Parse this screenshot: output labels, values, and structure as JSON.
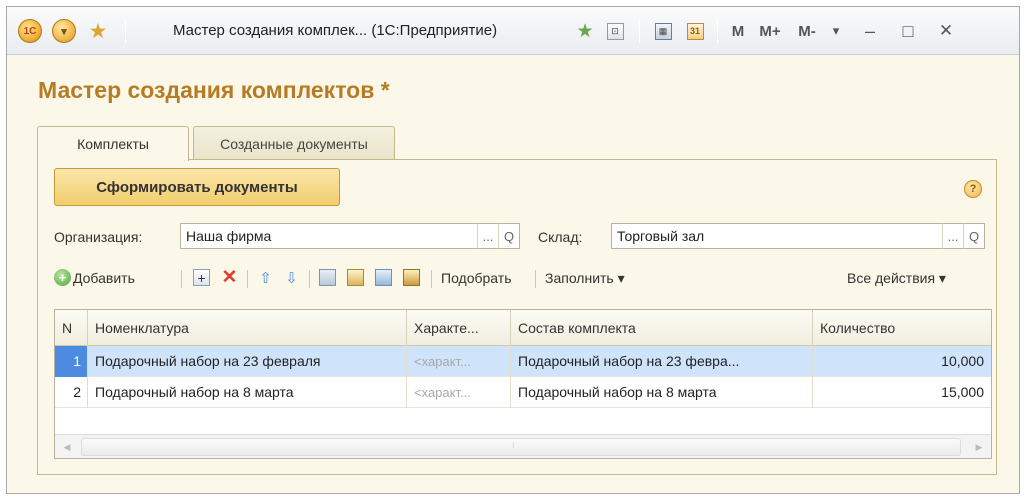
{
  "titlebar": {
    "title": "Мастер создания комплек... (1С:Предприятие)",
    "logo_text": "1С",
    "cal_text": "31",
    "m_label": "M",
    "m_plus_label": "M+",
    "m_minus_label": "M-",
    "minimize_glyph": "–",
    "restore_glyph": "□",
    "close_glyph": "✕",
    "dropdown_glyph": "▾"
  },
  "form": {
    "title": "Мастер создания комплектов *"
  },
  "tabs": [
    {
      "label": "Комплекты"
    },
    {
      "label": "Созданные документы"
    }
  ],
  "actions": {
    "generate_label": "Сформировать документы",
    "help_glyph": "?"
  },
  "fields": {
    "organization_label": "Организация:",
    "organization_value": "Наша фирма",
    "warehouse_label": "Склад:",
    "warehouse_value": "Торговый зал",
    "choose_glyph": "...",
    "search_glyph": "Q"
  },
  "commandbar": {
    "add_label": "Добавить",
    "pick_label": "Подобрать",
    "fill_label": "Заполнить ▾",
    "all_actions_label": "Все действия ▾"
  },
  "table": {
    "columns": [
      "N",
      "Номенклатура",
      "Характе...",
      "Состав комплекта",
      "Количество"
    ],
    "rows": [
      {
        "n": "1",
        "item": "Подарочный набор на 23 февраля",
        "characteristic": "<характ...",
        "kit": "Подарочный набор на 23 февра...",
        "quantity": "10,000",
        "selected": true
      },
      {
        "n": "2",
        "item": "Подарочный набор на 8 марта",
        "characteristic": "<характ...",
        "kit": "Подарочный набор на 8 марта",
        "quantity": "15,000",
        "selected": false
      }
    ]
  }
}
